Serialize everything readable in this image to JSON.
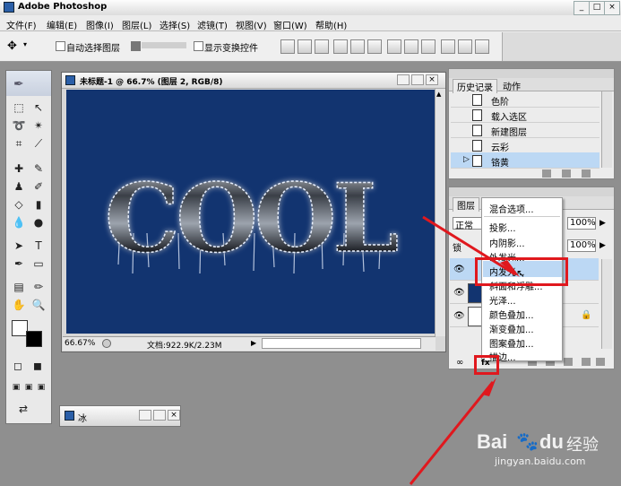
{
  "app": {
    "title": "Adobe Photoshop"
  },
  "menubar": {
    "items": [
      "文件(F)",
      "编辑(E)",
      "图像(I)",
      "图层(L)",
      "选择(S)",
      "滤镜(T)",
      "视图(V)",
      "窗口(W)",
      "帮助(H)"
    ]
  },
  "options_bar": {
    "auto_select_label": "自动选择图层",
    "show_transform_label": "显示变换控件"
  },
  "document": {
    "title": "未标题-1 @ 66.7% (图层 2, RGB/8)",
    "canvas_text": "COOL",
    "zoom": "66.67%",
    "doc_size": "文档:922.9K/2.23M"
  },
  "minimized_doc": {
    "title": "冰"
  },
  "history_panel": {
    "tabs": [
      "历史记录",
      "动作"
    ],
    "items": [
      "色阶",
      "载入选区",
      "新建图层",
      "云彩",
      "铬黄"
    ]
  },
  "layers_panel": {
    "tab": "图层",
    "blend_mode": "正常",
    "opacity": "100%",
    "fill": "100%",
    "lock_label": "锁"
  },
  "context_menu": {
    "items": [
      "混合选项...",
      "投影...",
      "内阴影...",
      "外发光...",
      "内发光...",
      "斜面和浮雕...",
      "光泽...",
      "颜色叠加...",
      "渐变叠加...",
      "图案叠加...",
      "描边..."
    ]
  },
  "watermark": {
    "brand": "Bai",
    "brand2": "du",
    "suffix": "经验",
    "url": "jingyan.baidu.com"
  },
  "colors": {
    "canvas_bg": "#123470",
    "highlight": "#bcd8f4",
    "annotation_red": "#e0181e"
  }
}
